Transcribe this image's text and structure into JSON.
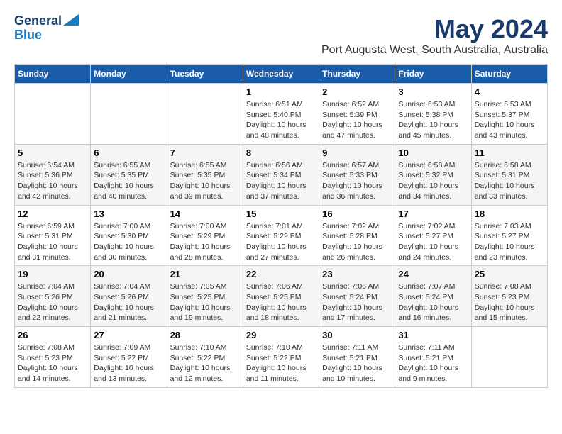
{
  "header": {
    "logo_line1": "General",
    "logo_line2": "Blue",
    "month_title": "May 2024",
    "location": "Port Augusta West, South Australia, Australia"
  },
  "calendar": {
    "weekdays": [
      "Sunday",
      "Monday",
      "Tuesday",
      "Wednesday",
      "Thursday",
      "Friday",
      "Saturday"
    ],
    "weeks": [
      [
        {
          "day": "",
          "info": ""
        },
        {
          "day": "",
          "info": ""
        },
        {
          "day": "",
          "info": ""
        },
        {
          "day": "1",
          "info": "Sunrise: 6:51 AM\nSunset: 5:40 PM\nDaylight: 10 hours\nand 48 minutes."
        },
        {
          "day": "2",
          "info": "Sunrise: 6:52 AM\nSunset: 5:39 PM\nDaylight: 10 hours\nand 47 minutes."
        },
        {
          "day": "3",
          "info": "Sunrise: 6:53 AM\nSunset: 5:38 PM\nDaylight: 10 hours\nand 45 minutes."
        },
        {
          "day": "4",
          "info": "Sunrise: 6:53 AM\nSunset: 5:37 PM\nDaylight: 10 hours\nand 43 minutes."
        }
      ],
      [
        {
          "day": "5",
          "info": "Sunrise: 6:54 AM\nSunset: 5:36 PM\nDaylight: 10 hours\nand 42 minutes."
        },
        {
          "day": "6",
          "info": "Sunrise: 6:55 AM\nSunset: 5:35 PM\nDaylight: 10 hours\nand 40 minutes."
        },
        {
          "day": "7",
          "info": "Sunrise: 6:55 AM\nSunset: 5:35 PM\nDaylight: 10 hours\nand 39 minutes."
        },
        {
          "day": "8",
          "info": "Sunrise: 6:56 AM\nSunset: 5:34 PM\nDaylight: 10 hours\nand 37 minutes."
        },
        {
          "day": "9",
          "info": "Sunrise: 6:57 AM\nSunset: 5:33 PM\nDaylight: 10 hours\nand 36 minutes."
        },
        {
          "day": "10",
          "info": "Sunrise: 6:58 AM\nSunset: 5:32 PM\nDaylight: 10 hours\nand 34 minutes."
        },
        {
          "day": "11",
          "info": "Sunrise: 6:58 AM\nSunset: 5:31 PM\nDaylight: 10 hours\nand 33 minutes."
        }
      ],
      [
        {
          "day": "12",
          "info": "Sunrise: 6:59 AM\nSunset: 5:31 PM\nDaylight: 10 hours\nand 31 minutes."
        },
        {
          "day": "13",
          "info": "Sunrise: 7:00 AM\nSunset: 5:30 PM\nDaylight: 10 hours\nand 30 minutes."
        },
        {
          "day": "14",
          "info": "Sunrise: 7:00 AM\nSunset: 5:29 PM\nDaylight: 10 hours\nand 28 minutes."
        },
        {
          "day": "15",
          "info": "Sunrise: 7:01 AM\nSunset: 5:29 PM\nDaylight: 10 hours\nand 27 minutes."
        },
        {
          "day": "16",
          "info": "Sunrise: 7:02 AM\nSunset: 5:28 PM\nDaylight: 10 hours\nand 26 minutes."
        },
        {
          "day": "17",
          "info": "Sunrise: 7:02 AM\nSunset: 5:27 PM\nDaylight: 10 hours\nand 24 minutes."
        },
        {
          "day": "18",
          "info": "Sunrise: 7:03 AM\nSunset: 5:27 PM\nDaylight: 10 hours\nand 23 minutes."
        }
      ],
      [
        {
          "day": "19",
          "info": "Sunrise: 7:04 AM\nSunset: 5:26 PM\nDaylight: 10 hours\nand 22 minutes."
        },
        {
          "day": "20",
          "info": "Sunrise: 7:04 AM\nSunset: 5:26 PM\nDaylight: 10 hours\nand 21 minutes."
        },
        {
          "day": "21",
          "info": "Sunrise: 7:05 AM\nSunset: 5:25 PM\nDaylight: 10 hours\nand 19 minutes."
        },
        {
          "day": "22",
          "info": "Sunrise: 7:06 AM\nSunset: 5:25 PM\nDaylight: 10 hours\nand 18 minutes."
        },
        {
          "day": "23",
          "info": "Sunrise: 7:06 AM\nSunset: 5:24 PM\nDaylight: 10 hours\nand 17 minutes."
        },
        {
          "day": "24",
          "info": "Sunrise: 7:07 AM\nSunset: 5:24 PM\nDaylight: 10 hours\nand 16 minutes."
        },
        {
          "day": "25",
          "info": "Sunrise: 7:08 AM\nSunset: 5:23 PM\nDaylight: 10 hours\nand 15 minutes."
        }
      ],
      [
        {
          "day": "26",
          "info": "Sunrise: 7:08 AM\nSunset: 5:23 PM\nDaylight: 10 hours\nand 14 minutes."
        },
        {
          "day": "27",
          "info": "Sunrise: 7:09 AM\nSunset: 5:22 PM\nDaylight: 10 hours\nand 13 minutes."
        },
        {
          "day": "28",
          "info": "Sunrise: 7:10 AM\nSunset: 5:22 PM\nDaylight: 10 hours\nand 12 minutes."
        },
        {
          "day": "29",
          "info": "Sunrise: 7:10 AM\nSunset: 5:22 PM\nDaylight: 10 hours\nand 11 minutes."
        },
        {
          "day": "30",
          "info": "Sunrise: 7:11 AM\nSunset: 5:21 PM\nDaylight: 10 hours\nand 10 minutes."
        },
        {
          "day": "31",
          "info": "Sunrise: 7:11 AM\nSunset: 5:21 PM\nDaylight: 10 hours\nand 9 minutes."
        },
        {
          "day": "",
          "info": ""
        }
      ]
    ]
  }
}
